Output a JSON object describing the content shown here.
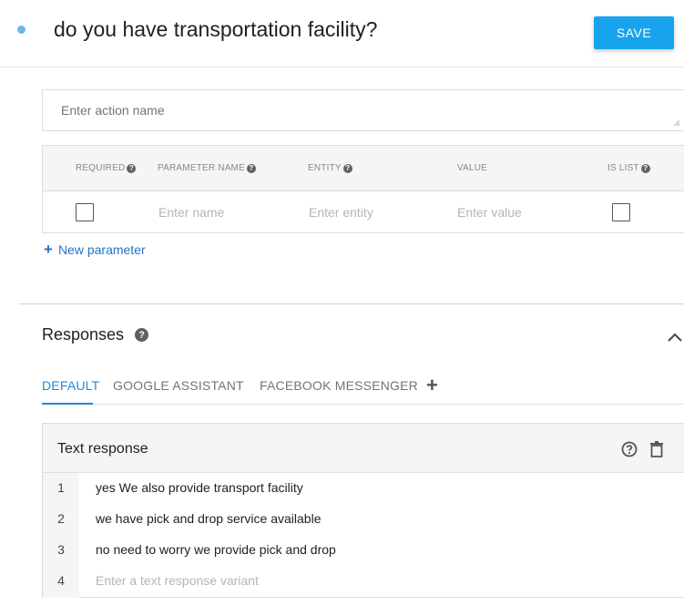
{
  "header": {
    "intent_title": "do you have transportation facility?",
    "save_label": "SAVE"
  },
  "action": {
    "placeholder": "Enter action name"
  },
  "parameters": {
    "columns": [
      "REQUIRED",
      "PARAMETER NAME",
      "ENTITY",
      "VALUE",
      "IS LIST"
    ],
    "row": {
      "name_placeholder": "Enter name",
      "entity_placeholder": "Enter entity",
      "value_placeholder": "Enter value"
    },
    "new_parameter_label": "New parameter"
  },
  "responses": {
    "title": "Responses",
    "tabs": [
      "DEFAULT",
      "GOOGLE ASSISTANT",
      "FACEBOOK MESSENGER"
    ],
    "active_tab": "DEFAULT",
    "text_response": {
      "title": "Text response",
      "rows": [
        {
          "num": "1",
          "text": "yes We also provide transport facility"
        },
        {
          "num": "2",
          "text": "we have pick and drop service available"
        },
        {
          "num": "3",
          "text": "no need to worry we provide pick and drop"
        }
      ],
      "new_row": {
        "num": "4",
        "placeholder": "Enter a text response variant"
      }
    }
  },
  "colors": {
    "accent": "#18a3ee",
    "link": "#1f74c8",
    "tab_active": "#1f8ad6",
    "status_dot": "#69b7ea"
  },
  "icons": [
    "status-dot",
    "help-icon",
    "resize-handle-icon",
    "plus-icon",
    "chevron-up-icon",
    "trash-icon"
  ]
}
